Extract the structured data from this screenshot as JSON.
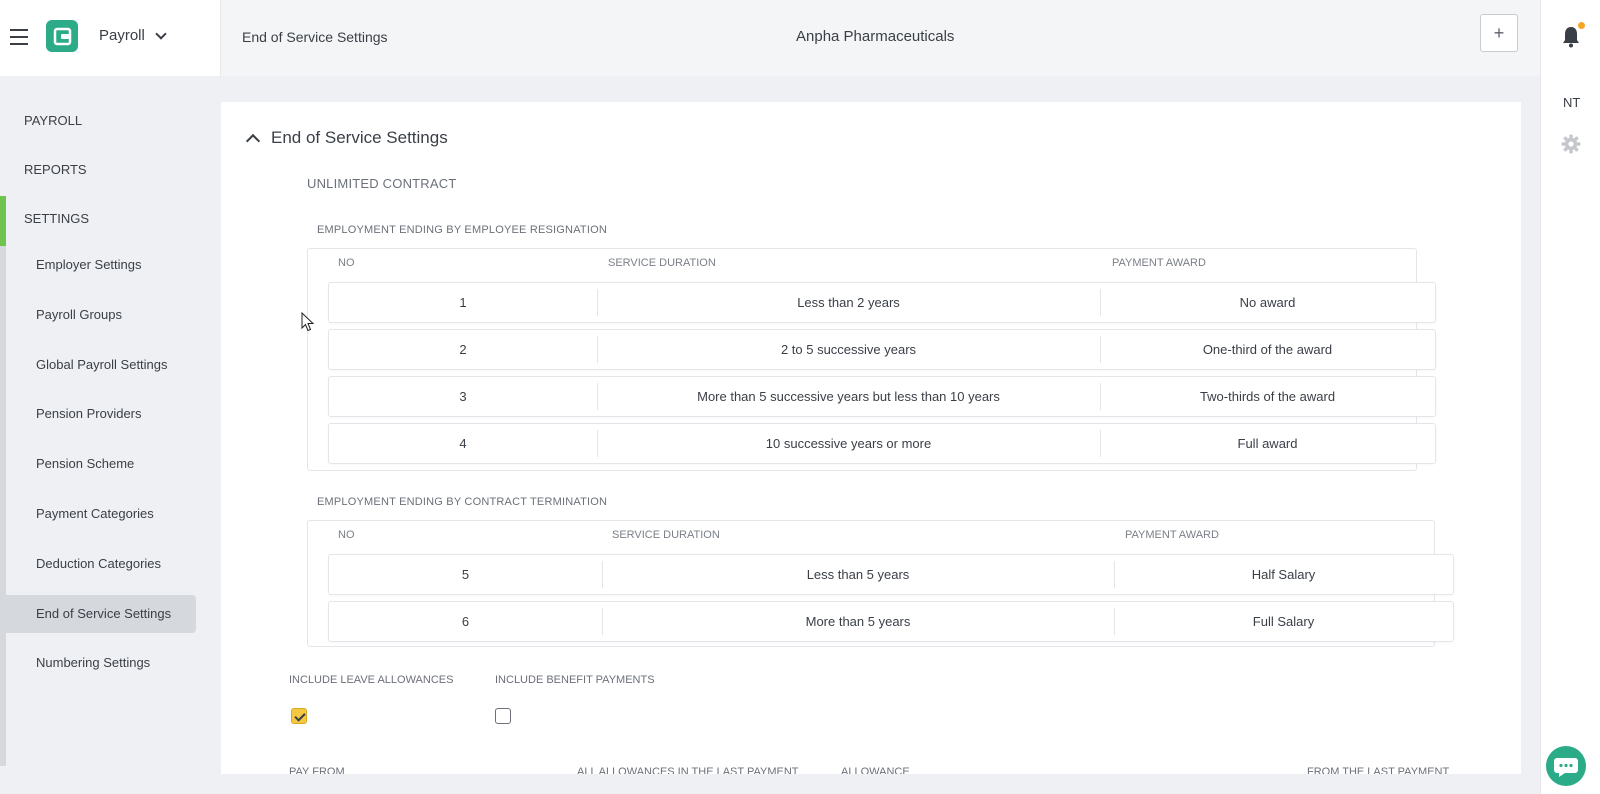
{
  "header": {
    "app_name": "Payroll",
    "breadcrumb": "End of Service Settings",
    "company": "Anpha Pharmaceuticals",
    "add_label": "+",
    "user_initials": "NT"
  },
  "sidebar": {
    "top_items": [
      {
        "label": "PAYROLL"
      },
      {
        "label": "REPORTS"
      },
      {
        "label": "SETTINGS",
        "active": true
      }
    ],
    "sub_items": [
      {
        "label": "Employer Settings"
      },
      {
        "label": "Payroll Groups"
      },
      {
        "label": "Global Payroll Settings"
      },
      {
        "label": "Pension Providers"
      },
      {
        "label": "Pension Scheme"
      },
      {
        "label": "Payment Categories"
      },
      {
        "label": "Deduction Categories"
      },
      {
        "label": "End of Service Settings",
        "active": true
      },
      {
        "label": "Numbering Settings"
      }
    ]
  },
  "main": {
    "title": "End of Service Settings",
    "contract_label": "UNLIMITED CONTRACT",
    "resignation": {
      "label": "EMPLOYMENT ENDING BY EMPLOYEE RESIGNATION",
      "headers": {
        "no": "NO",
        "duration": "SERVICE DURATION",
        "award": "PAYMENT AWARD"
      },
      "rows": [
        {
          "no": "1",
          "duration": "Less than 2 years",
          "award": "No award"
        },
        {
          "no": "2",
          "duration": "2 to 5 successive years",
          "award": "One-third of the award"
        },
        {
          "no": "3",
          "duration": "More than 5 successive years but less than 10 years",
          "award": "Two-thirds of the award"
        },
        {
          "no": "4",
          "duration": "10 successive years or more",
          "award": "Full award"
        }
      ]
    },
    "termination": {
      "label": "EMPLOYMENT ENDING BY CONTRACT TERMINATION",
      "headers": {
        "no": "NO",
        "duration": "SERVICE DURATION",
        "award": "PAYMENT AWARD"
      },
      "rows": [
        {
          "no": "5",
          "duration": "Less than 5 years",
          "award": "Half Salary"
        },
        {
          "no": "6",
          "duration": "More than 5 years",
          "award": "Full Salary"
        }
      ]
    },
    "options": {
      "include_leave_label": "INCLUDE LEAVE ALLOWANCES",
      "include_leave_checked": true,
      "include_benefit_label": "INCLUDE BENEFIT PAYMENTS",
      "include_benefit_checked": false
    },
    "bottom_labels": {
      "pay_from": "PAY FROM",
      "all_allowances": "ALL ALLOWANCES IN THE LAST PAYMENT",
      "allowance": "ALLOWANCE",
      "from_last": "FROM THE LAST PAYMENT"
    }
  },
  "colors": {
    "brand": "#2bab87",
    "settings_accent": "#6fc44f",
    "checkbox_on": "#f5c842",
    "notification_dot": "#f5a623"
  },
  "icons": [
    "menu-icon",
    "app-logo-icon",
    "chevron-down-icon",
    "plus-icon",
    "bell-icon",
    "gear-icon",
    "chevron-up-icon",
    "checkmark-icon",
    "chat-icon",
    "mouse-cursor-icon"
  ]
}
